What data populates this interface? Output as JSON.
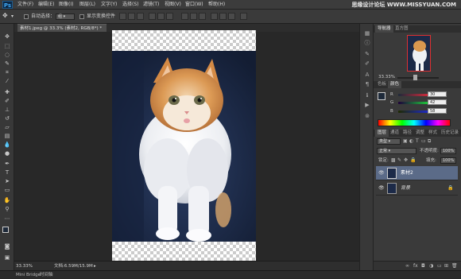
{
  "app": {
    "logo": "Ps",
    "watermark": "思缘设计论坛 WWW.MISSYUAN.COM"
  },
  "menu": [
    "文件(F)",
    "编辑(E)",
    "图像(I)",
    "图层(L)",
    "文字(Y)",
    "选择(S)",
    "滤镜(T)",
    "视图(V)",
    "窗口(W)",
    "帮助(H)"
  ],
  "options": {
    "auto_select_label": "自动选择：",
    "auto_select_value": "组",
    "show_transform_label": "显示变换控件"
  },
  "document": {
    "tab_title": "素材1.jpeg @ 33.3% (素材2, RGB/8*) *",
    "tab_close": "×"
  },
  "status": {
    "zoom": "33.33%",
    "doc_info": "文档:6.59M/15.9M"
  },
  "bottom_tabs": [
    "Mini Bridge",
    "时间轴"
  ],
  "navigator": {
    "tabs": [
      "导航器",
      "直方图"
    ],
    "zoom": "33.33%"
  },
  "color_panel": {
    "tabs": [
      "色板",
      "颜色"
    ],
    "channels": [
      {
        "key": "R",
        "value": "30"
      },
      {
        "key": "G",
        "value": "42"
      },
      {
        "key": "B",
        "value": "58"
      }
    ]
  },
  "layers_panel": {
    "tabs": [
      "图层",
      "通道",
      "路径",
      "调整",
      "样式",
      "历史记录"
    ],
    "filter": "类型",
    "blend_mode": "正常",
    "opacity_label": "不透明度:",
    "opacity_value": "100%",
    "lock_label": "锁定:",
    "fill_label": "填充:",
    "fill_value": "100%",
    "layers": [
      {
        "name": "素材2",
        "selected": true
      },
      {
        "name": "背景",
        "selected": false
      }
    ]
  },
  "colors": {
    "accent": "#3fa9f5",
    "selected_layer": "#5b6b88",
    "fg_swatch": "#1e2a3a"
  }
}
